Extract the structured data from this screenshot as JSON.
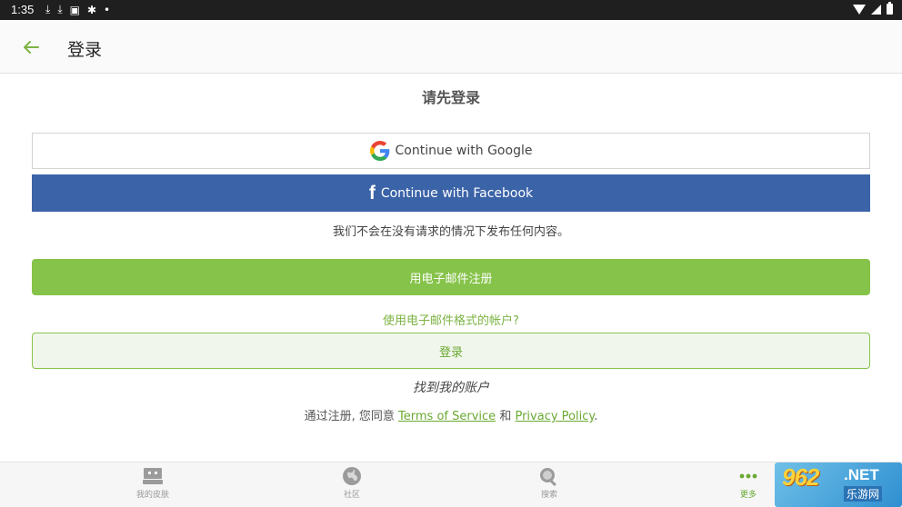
{
  "status_bar": {
    "time": "1:35"
  },
  "app_bar": {
    "title": "登录"
  },
  "login": {
    "heading": "请先登录",
    "google_label": "Continue with Google",
    "facebook_label": "Continue with Facebook",
    "privacy_note": "我们不会在没有请求的情况下发布任何内容。",
    "email_register_label": "用电子邮件注册",
    "email_question": "使用电子邮件格式的帐户?",
    "login_label": "登录",
    "find_account": "找到我的账户",
    "agreement_prefix": "通过注册, 您同意",
    "terms_link": "Terms of Service",
    "and_text": "和",
    "privacy_link": "Privacy Policy",
    "agreement_end": "."
  },
  "bottom_nav": {
    "items": [
      {
        "label": "我的皮肤",
        "icon": "skin-icon"
      },
      {
        "label": "社区",
        "icon": "globe-icon"
      },
      {
        "label": "搜索",
        "icon": "search-icon"
      },
      {
        "label": "更多",
        "icon": "more-icon"
      }
    ]
  },
  "watermark": {
    "brand": "962",
    "suffix": ".NET",
    "sub": "乐游网"
  },
  "colors": {
    "accent": "#86c34a",
    "facebook": "#3b63a8",
    "status_bar": "#1f1f1f"
  }
}
